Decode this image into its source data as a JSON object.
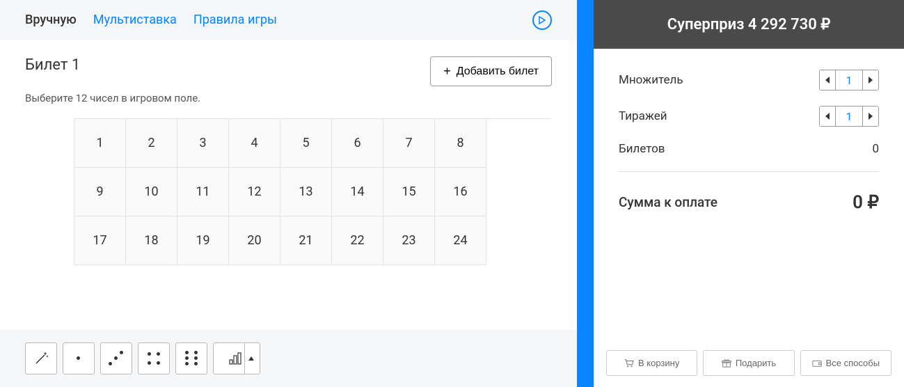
{
  "tabs": {
    "manual": "Вручную",
    "multi": "Мультиставка",
    "rules": "Правила игры"
  },
  "ticket": {
    "title": "Билет 1",
    "add_label": "Добавить билет",
    "hint": "Выберите 12 чисел в игровом поле.",
    "numbers": [
      "1",
      "2",
      "3",
      "4",
      "5",
      "6",
      "7",
      "8",
      "9",
      "10",
      "11",
      "12",
      "13",
      "14",
      "15",
      "16",
      "17",
      "18",
      "19",
      "20",
      "21",
      "22",
      "23",
      "24"
    ]
  },
  "superprize": {
    "label": "Суперприз",
    "amount": "4 292 730",
    "currency": "₽"
  },
  "summary": {
    "multiplier_label": "Множитель",
    "multiplier_value": "1",
    "draws_label": "Тиражей",
    "draws_value": "1",
    "tickets_label": "Билетов",
    "tickets_value": "0",
    "total_label": "Сумма к оплате",
    "total_value": "0",
    "currency": "₽"
  },
  "actions": {
    "cart": "В корзину",
    "gift": "Подарить",
    "all_methods": "Все способы"
  },
  "icons": {
    "wand": "wand-icon",
    "dice1": "dice-1-icon",
    "dice3": "dice-3-icon",
    "dice4": "dice-4-icon",
    "dice6": "dice-6-icon",
    "stats": "stats-icon"
  }
}
